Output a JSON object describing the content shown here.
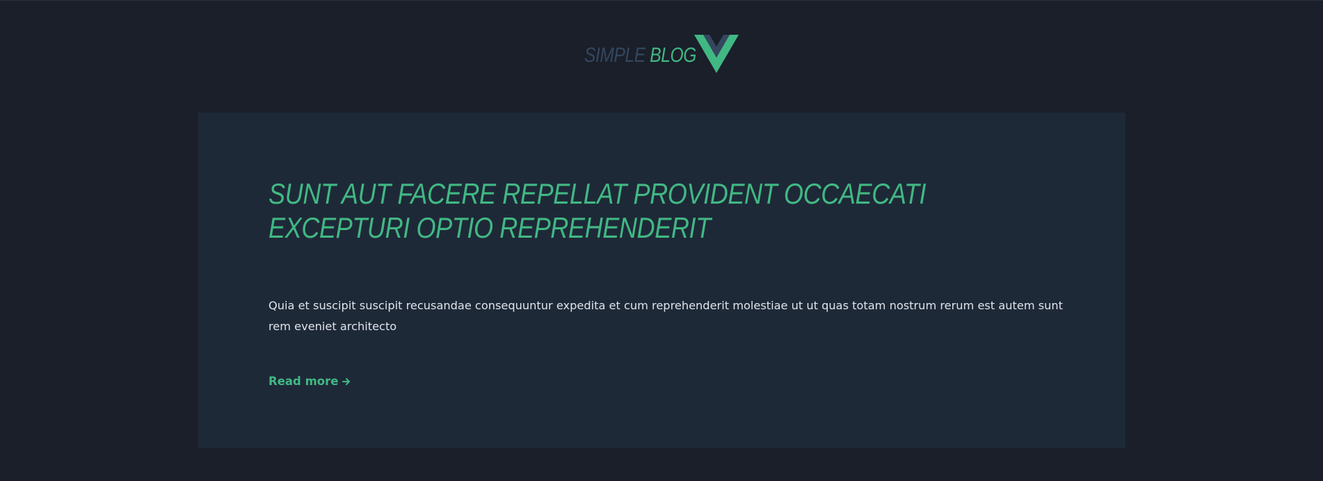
{
  "header": {
    "logo_word_1": "SIMPLE",
    "logo_word_2": "BLOG",
    "logo_icon": "vue-logo-icon"
  },
  "post": {
    "title": "SUNT AUT FACERE REPELLAT PROVIDENT OCCAECATI EXCEPTURI OPTIO REPREHENDERIT",
    "excerpt": "Quia et suscipit suscipit recusandae consequuntur expedita et cum reprehenderit molestiae ut ut quas totam nostrum rerum est autem sunt rem eveniet architecto",
    "read_more_label": "Read more",
    "read_more_icon": "arrow-right-icon"
  },
  "colors": {
    "background": "#1a1f2a",
    "card": "#1e2938",
    "accent": "#41b883",
    "accent_dark": "#34475e",
    "text": "#dfe3ea"
  }
}
